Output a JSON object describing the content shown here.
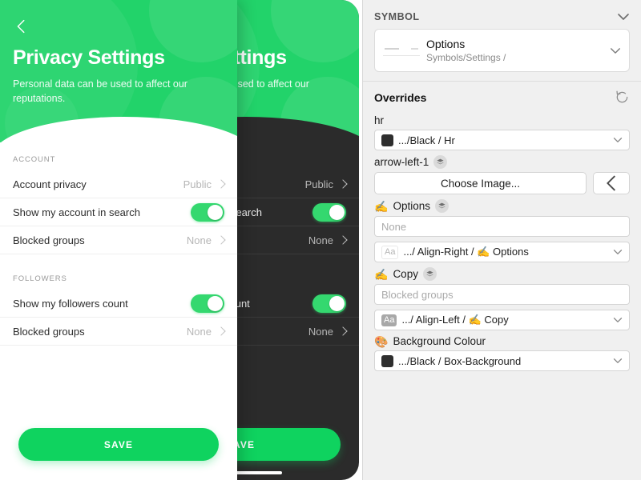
{
  "mockup": {
    "back_icon": "chevron-left-icon",
    "title": "Privacy Settings",
    "subtitle": "Personal data can be used to affect our reputations.",
    "sections": [
      {
        "label": "ACCOUNT",
        "rows": [
          {
            "label": "Account privacy",
            "type": "value",
            "value": "Public"
          },
          {
            "label": "Show my account in search",
            "type": "toggle",
            "value": "on"
          },
          {
            "label": "Blocked groups",
            "type": "value",
            "value": "None"
          }
        ]
      },
      {
        "label": "FOLLOWERS",
        "rows": [
          {
            "label": "Show my followers count",
            "type": "toggle",
            "value": "on"
          },
          {
            "label": "Blocked groups",
            "type": "value",
            "value": "None"
          }
        ]
      }
    ],
    "save_label": "SAVE",
    "accent_green": "#22d36a",
    "button_green": "#0fd35f",
    "dark_background": "#2b2b2b"
  },
  "inspector": {
    "header": {
      "title": "SYMBOL",
      "collapse_icon": "chevron-down-icon"
    },
    "symbol": {
      "name": "Options",
      "path": "Symbols/Settings /",
      "dropdown_icon": "chevron-down-icon",
      "thumbnail": "symbol-thumbnail"
    },
    "overrides": {
      "title": "Overrides",
      "reset_icon": "reset-arrow-icon",
      "items": [
        {
          "label": "hr",
          "label_emoji": "",
          "has_layer_badge": false,
          "control": "select",
          "swatch": "#2e2e2e",
          "value": ".../Black / Hr"
        },
        {
          "label": "arrow-left-1",
          "label_emoji": "",
          "has_layer_badge": true,
          "control": "image",
          "button_label": "Choose Image...",
          "preview_icon": "chevron-left-icon"
        },
        {
          "label": "Options",
          "label_emoji": "✍️",
          "has_layer_badge": true,
          "control": "text-and-select",
          "text_placeholder": "None",
          "text_value": "",
          "badge": "Aa",
          "badge_style": "light",
          "value": ".../ Align-Right / ✍️ Options"
        },
        {
          "label": "Copy",
          "label_emoji": "✍️",
          "has_layer_badge": true,
          "control": "text-and-select",
          "text_placeholder": "Blocked groups",
          "text_value": "",
          "badge": "Aa",
          "badge_style": "dark",
          "value": ".../ Align-Left / ✍️ Copy"
        },
        {
          "label": "Background Colour",
          "label_emoji": "🎨",
          "has_layer_badge": false,
          "control": "select",
          "swatch": "#2e2e2e",
          "value": ".../Black / Box-Background"
        }
      ]
    }
  }
}
